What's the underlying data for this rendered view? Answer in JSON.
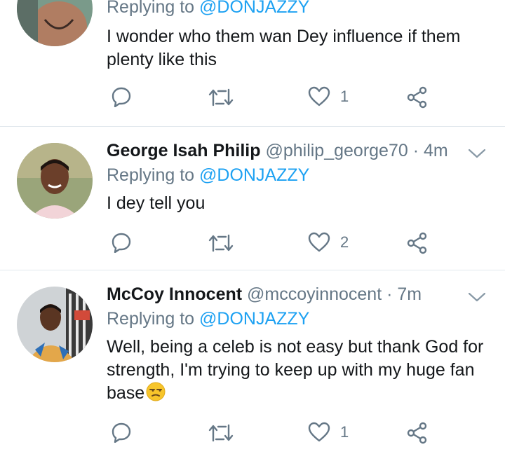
{
  "tweets": [
    {
      "reply_prefix": "Replying to",
      "mention": "@DONJAZZY",
      "text": "I wonder who them wan Dey influence if them plenty like this",
      "likes": "1"
    },
    {
      "name": "George Isah Philip",
      "handle": "@philip_george70",
      "separator": "·",
      "time": "4m",
      "reply_prefix": "Replying to",
      "mention": "@DONJAZZY",
      "text": "I dey tell you",
      "likes": "2"
    },
    {
      "name": "McCoy Innocent",
      "handle": "@mccoyinnocent",
      "separator": "·",
      "time": "7m",
      "reply_prefix": "Replying to",
      "mention": "@DONJAZZY",
      "text": "Well, being a celeb is not easy but thank God for strength, I'm trying to keep up with my huge fan base",
      "likes": "1"
    }
  ],
  "icons": [
    "reply-icon",
    "retweet-icon",
    "like-icon",
    "share-icon",
    "chevron-down-icon",
    "unamused-face-emoji"
  ],
  "colors": {
    "text": "#14171a",
    "secondary": "#657786",
    "mention": "#1da1f2",
    "divider": "#e1e8ed"
  }
}
